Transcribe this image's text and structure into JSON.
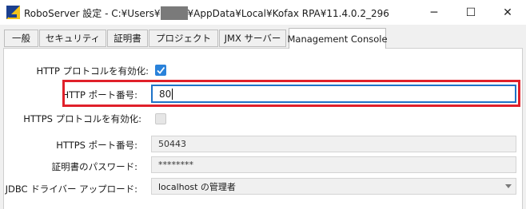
{
  "window": {
    "title_prefix": "RoboServer 設定 - C:¥Users¥",
    "title_suffix": "¥AppData¥Local¥Kofax RPA¥11.4.0.2_296",
    "minimize_glyph": "─",
    "maximize_glyph": "☐",
    "close_glyph": "✕"
  },
  "tabs": [
    {
      "label": "一般"
    },
    {
      "label": "セキュリティ"
    },
    {
      "label": "証明書"
    },
    {
      "label": "プロジェクト"
    },
    {
      "label": "JMX サーバー"
    },
    {
      "label": "Management Console",
      "active": true
    }
  ],
  "form": {
    "http_enable_label": "HTTP プロトコルを有効化:",
    "http_enabled": true,
    "http_port_label": "HTTP ポート番号:",
    "http_port_value": "80",
    "https_enable_label": "HTTPS プロトコルを有効化:",
    "https_enabled": false,
    "https_port_label": "HTTPS ポート番号:",
    "https_port_value": "50443",
    "cert_password_label": "証明書のパスワード:",
    "cert_password_value": "********",
    "jdbc_upload_label": "JDBC ドライバー アップロード:",
    "jdbc_upload_value": "localhost の管理者"
  },
  "colors": {
    "accent": "#2a82da",
    "focus_border": "#1e73c8",
    "highlight_box": "#e0202a"
  },
  "icons": {
    "app": "roboserver-app-icon",
    "checkmark": "checkmark-icon",
    "dropdown": "chevron-down-icon"
  }
}
